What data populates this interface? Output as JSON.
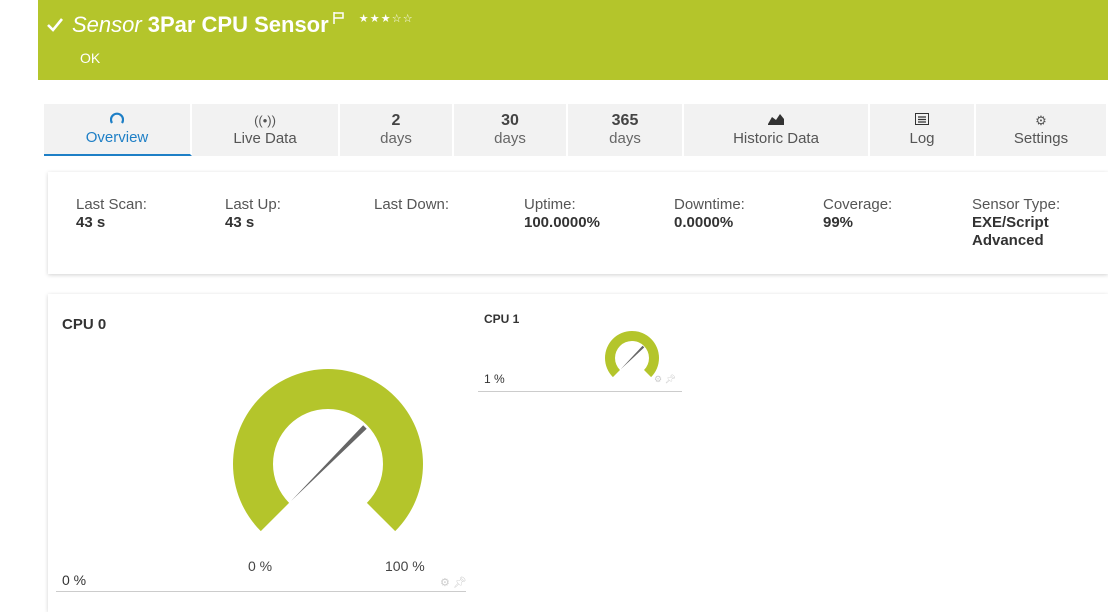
{
  "header": {
    "kind": "Sensor",
    "name": "3Par CPU Sensor",
    "status": "OK",
    "stars_filled": 3,
    "stars_total": 5
  },
  "tabs": [
    {
      "icon": "gauge-icon",
      "label": "Overview",
      "active": true
    },
    {
      "icon": "live-signal-icon",
      "label": "Live Data"
    },
    {
      "num": "2",
      "sub": "days"
    },
    {
      "num": "30",
      "sub": "days"
    },
    {
      "num": "365",
      "sub": "days"
    },
    {
      "icon": "area-chart-icon",
      "label": "Historic Data"
    },
    {
      "icon": "log-icon",
      "label": "Log"
    },
    {
      "icon": "gear-icon",
      "label": "Settings"
    }
  ],
  "stats": [
    {
      "key": "Last Scan:",
      "value": "43 s"
    },
    {
      "key": "Last Up:",
      "value": "43 s"
    },
    {
      "key": "Last Down:",
      "value": ""
    },
    {
      "key": "Uptime:",
      "value": "100.0000%"
    },
    {
      "key": "Downtime:",
      "value": "0.0000%"
    },
    {
      "key": "Coverage:",
      "value": "99%"
    },
    {
      "key": "Sensor Type:",
      "value": "EXE/Script Advanced"
    }
  ],
  "gauges": [
    {
      "title": "CPU 0",
      "value_label": "0 %",
      "value": 0,
      "min_label": "0 %",
      "max_label": "100 %",
      "min": 0,
      "max": 100
    },
    {
      "title": "CPU 1",
      "value_label": "1 %",
      "value": 1,
      "min": 0,
      "max": 100
    }
  ],
  "colors": {
    "accent": "#b4c52b",
    "tab_active": "#1e7fc6",
    "needle": "#666666"
  }
}
